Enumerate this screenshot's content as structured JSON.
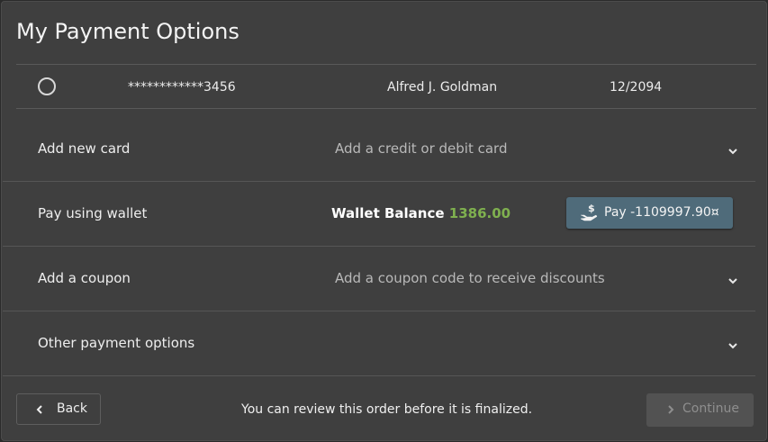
{
  "title": "My Payment Options",
  "saved_card": {
    "number": "************3456",
    "name": "Alfred J. Goldman",
    "expiry": "12/2094"
  },
  "add_card": {
    "label": "Add new card",
    "description": "Add a credit or debit card"
  },
  "wallet": {
    "label": "Pay using wallet",
    "balance_label": "Wallet Balance",
    "balance_value": "1386.00",
    "pay_label": "Pay -1109997.90¤"
  },
  "coupon": {
    "label": "Add a coupon",
    "description": "Add a coupon code to receive discounts"
  },
  "other": {
    "label": "Other payment options"
  },
  "footer": {
    "back_label": "Back",
    "notice": "You can review this order before it is finalized.",
    "continue_label": "Continue"
  },
  "colors": {
    "wallet_amount": "#7fb04f",
    "pay_button": "#4f6b7a"
  },
  "icons": {
    "chevron": "chevron-down-icon",
    "pay": "hand-dollar-icon",
    "back": "chevron-left-icon",
    "continue": "chevron-right-icon"
  }
}
